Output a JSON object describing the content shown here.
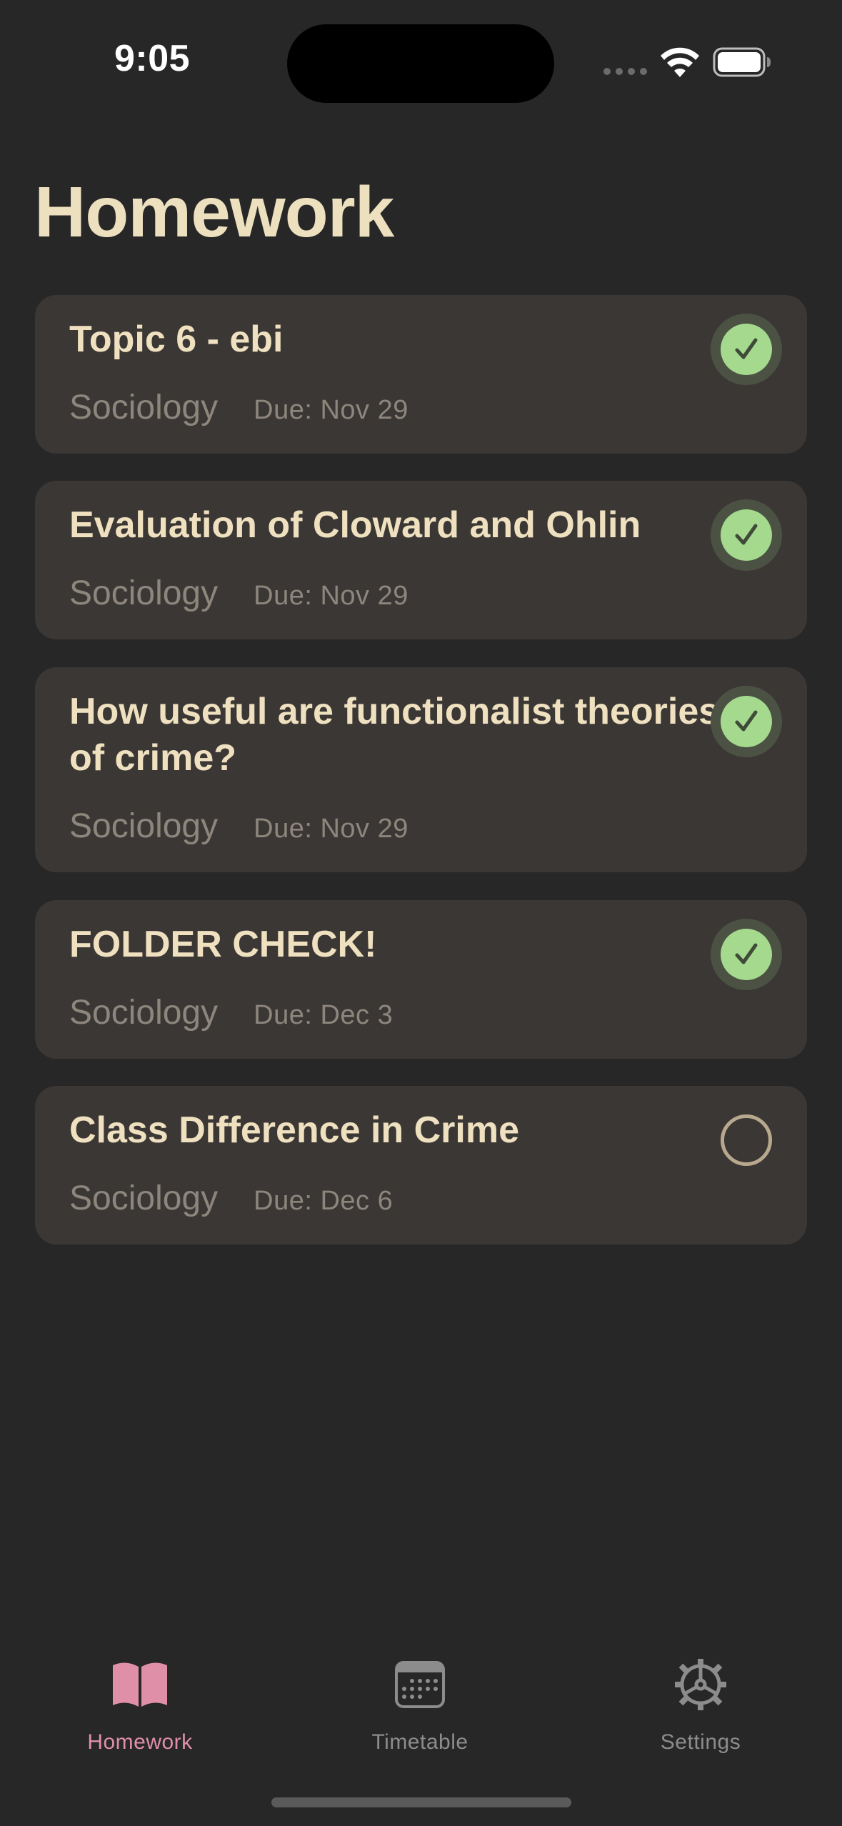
{
  "status_bar": {
    "time": "9:05"
  },
  "page": {
    "title": "Homework"
  },
  "homework_items": [
    {
      "title": "Topic 6 - ebi",
      "subject": "Sociology",
      "due": "Due: Nov 29",
      "completed": true
    },
    {
      "title": "Evaluation of Cloward and Ohlin",
      "subject": "Sociology",
      "due": "Due: Nov 29",
      "completed": true
    },
    {
      "title": "How useful are functionalist theories of crime?",
      "subject": "Sociology",
      "due": "Due: Nov 29",
      "completed": true
    },
    {
      "title": "FOLDER CHECK!",
      "subject": "Sociology",
      "due": "Due: Dec 3",
      "completed": true
    },
    {
      "title": "Class Difference in Crime",
      "subject": "Sociology",
      "due": "Due: Dec 6",
      "completed": false
    }
  ],
  "tab_bar": {
    "tabs": [
      {
        "label": "Homework",
        "icon": "book-icon",
        "active": true
      },
      {
        "label": "Timetable",
        "icon": "calendar-icon",
        "active": false
      },
      {
        "label": "Settings",
        "icon": "gear-icon",
        "active": false
      }
    ]
  },
  "colors": {
    "background": "#272727",
    "card": "#3b3735",
    "title": "#ede0bf",
    "check_green": "#a4d98e",
    "accent_pink": "#e08fa8"
  }
}
